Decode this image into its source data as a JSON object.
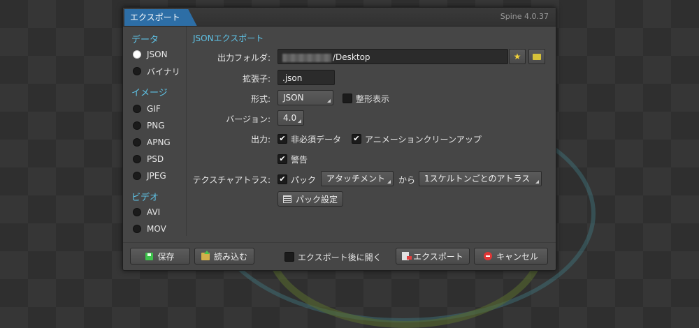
{
  "dialog": {
    "title": "エクスポート",
    "version": "Spine 4.0.37"
  },
  "sidebar": {
    "sections": [
      {
        "header": "データ",
        "items": [
          {
            "label": "JSON",
            "selected": true
          },
          {
            "label": "バイナリ",
            "selected": false
          }
        ]
      },
      {
        "header": "イメージ",
        "items": [
          {
            "label": "GIF"
          },
          {
            "label": "PNG"
          },
          {
            "label": "APNG"
          },
          {
            "label": "PSD"
          },
          {
            "label": "JPEG"
          }
        ]
      },
      {
        "header": "ビデオ",
        "items": [
          {
            "label": "AVI"
          },
          {
            "label": "MOV"
          }
        ]
      }
    ]
  },
  "content": {
    "title": "JSONエクスポート",
    "output_folder": {
      "label": "出力フォルダ:",
      "value": "/Desktop",
      "favorite_icon": "star-icon",
      "browse_icon": "folder-search-icon"
    },
    "extension": {
      "label": "拡張子:",
      "value": ".json"
    },
    "format": {
      "label": "形式:",
      "value": "JSON",
      "pretty_print_label": "整形表示",
      "pretty_print_checked": false
    },
    "version": {
      "label": "バージョン:",
      "value": "4.0"
    },
    "output": {
      "label": "出力:",
      "nonessential_label": "非必須データ",
      "nonessential_checked": true,
      "animation_cleanup_label": "アニメーションクリーンアップ",
      "animation_cleanup_checked": true,
      "warnings_label": "警告",
      "warnings_checked": true
    },
    "texture_atlas": {
      "label": "テクスチャアトラス:",
      "pack_label": "パック",
      "pack_checked": true,
      "source_value": "アタッチメント",
      "from_label": "から",
      "target_value": "1スケルトンごとのアトラス",
      "pack_settings_label": "パック設定"
    },
    "check_mark": "✔"
  },
  "footer": {
    "save_label": "保存",
    "load_label": "読み込む",
    "open_after_export_label": "エクスポート後に開く",
    "open_after_export_checked": false,
    "export_label": "エクスポート",
    "cancel_label": "キャンセル"
  },
  "colors": {
    "accent": "#2d6ea6",
    "section_header": "#5fc4e8",
    "panel": "#464646"
  }
}
